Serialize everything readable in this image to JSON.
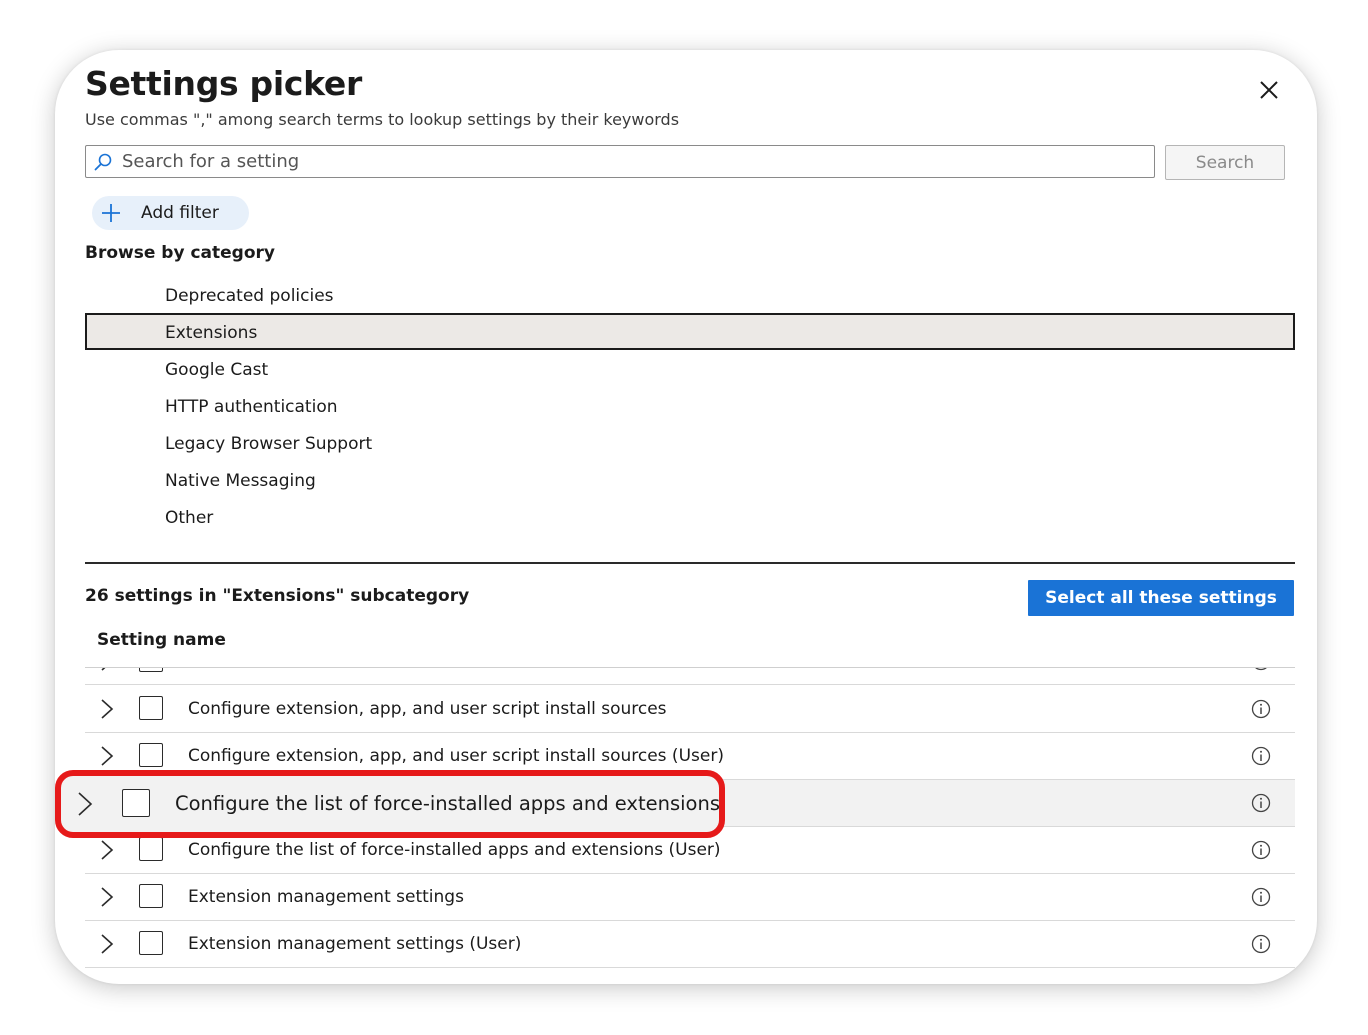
{
  "dialog": {
    "title": "Settings picker",
    "subtitle": "Use commas \",\" among search terms to lookup settings by their keywords",
    "close_icon": "close-icon"
  },
  "search": {
    "placeholder": "Search for a setting",
    "value": "",
    "button_label": "Search"
  },
  "filter": {
    "add_label": "Add filter"
  },
  "browse": {
    "title": "Browse by category",
    "categories": [
      {
        "label": "Deprecated policies",
        "selected": false
      },
      {
        "label": "Extensions",
        "selected": true
      },
      {
        "label": "Google Cast",
        "selected": false
      },
      {
        "label": "HTTP authentication",
        "selected": false
      },
      {
        "label": "Legacy Browser Support",
        "selected": false
      },
      {
        "label": "Native Messaging",
        "selected": false
      },
      {
        "label": "Other",
        "selected": false
      }
    ]
  },
  "results": {
    "count_text": "26 settings in \"Extensions\" subcategory",
    "select_all_label": "Select all these settings",
    "column_header": "Setting name",
    "rows": [
      {
        "name": "Configure extension, app, and user script install sources",
        "checked": false
      },
      {
        "name": "Configure extension, app, and user script install sources (User)",
        "checked": false
      },
      {
        "name": "Configure the list of force-installed apps and extensions",
        "checked": false,
        "highlighted": true
      },
      {
        "name": "Configure the list of force-installed apps and extensions (User)",
        "checked": false
      },
      {
        "name": "Extension management settings",
        "checked": false
      },
      {
        "name": "Extension management settings (User)",
        "checked": false
      }
    ]
  },
  "colors": {
    "accent": "#1a73d6",
    "callout": "#e61a1a",
    "selected_bg": "#ece9e6",
    "filter_pill_bg": "#e7f0fa"
  }
}
